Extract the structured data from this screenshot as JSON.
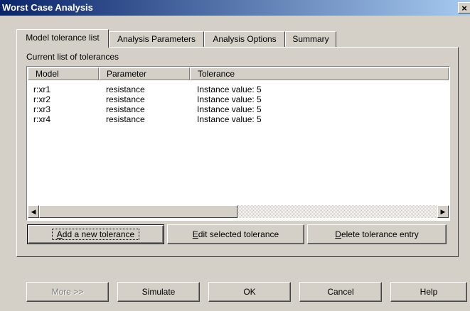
{
  "window": {
    "title": "Worst Case Analysis",
    "close_glyph": "×"
  },
  "tabs": [
    {
      "label": "Model tolerance list",
      "active": true
    },
    {
      "label": "Analysis Parameters",
      "active": false
    },
    {
      "label": "Analysis Options",
      "active": false
    },
    {
      "label": "Summary",
      "active": false
    }
  ],
  "panel": {
    "caption": "Current list of tolerances"
  },
  "list": {
    "columns": [
      "Model",
      "Parameter",
      "Tolerance"
    ],
    "rows": [
      {
        "model": "r:xr1",
        "parameter": "resistance",
        "tolerance": "Instance value: 5"
      },
      {
        "model": "r:xr2",
        "parameter": "resistance",
        "tolerance": "Instance value: 5"
      },
      {
        "model": "r:xr3",
        "parameter": "resistance",
        "tolerance": "Instance value: 5"
      },
      {
        "model": "r:xr4",
        "parameter": "resistance",
        "tolerance": "Instance value: 5"
      }
    ],
    "scroll_left_glyph": "◀",
    "scroll_right_glyph": "▶"
  },
  "actions": {
    "add": {
      "mnemonic": "A",
      "rest": "dd a new tolerance"
    },
    "edit": {
      "mnemonic": "E",
      "rest": "dit selected tolerance"
    },
    "delete": {
      "mnemonic": "D",
      "rest": "elete tolerance entry"
    }
  },
  "footer": {
    "more": "More >>",
    "simulate": "Simulate",
    "ok": "OK",
    "cancel": "Cancel",
    "help": "Help"
  },
  "colors": {
    "titlebar_start": "#0a246a",
    "titlebar_end": "#a6caf0",
    "face": "#d4d0c8"
  }
}
